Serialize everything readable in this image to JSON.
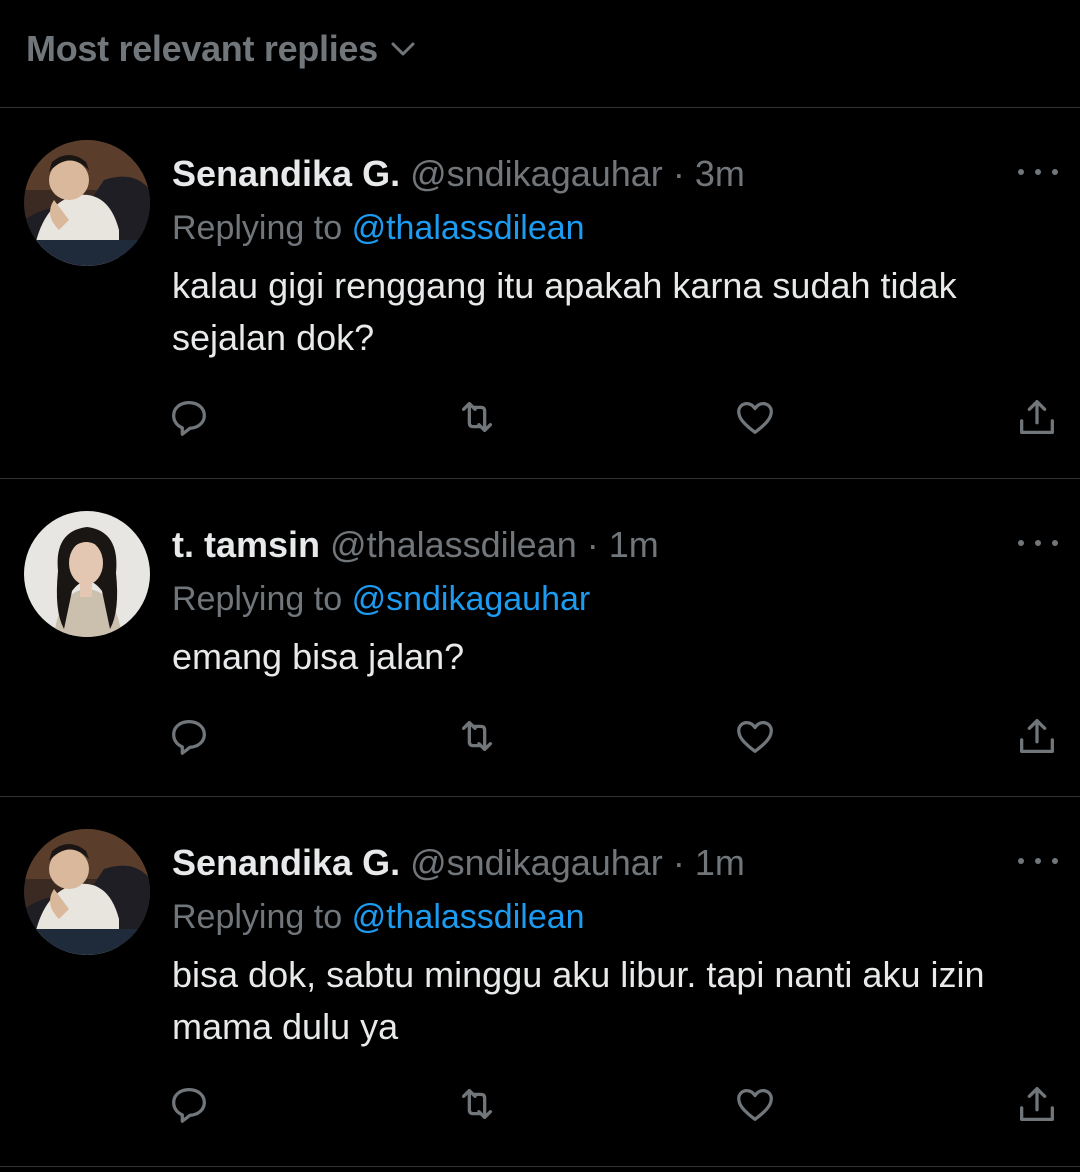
{
  "header": {
    "sort_label": "Most relevant replies",
    "chevron_icon": "chevron-down-icon"
  },
  "colors": {
    "background": "#000000",
    "primary_text": "#e7e9ea",
    "secondary_text": "#71767b",
    "link": "#1d9bf0",
    "divider": "#2f3336"
  },
  "tweets": [
    {
      "display_name": "Senandika G.",
      "handle": "@sndikagauhar",
      "separator": "·",
      "time": "3m",
      "replying_prefix": "Replying to",
      "replying_to": "@thalassdilean",
      "text": "kalau gigi renggang itu apakah karna sudah tidak sejalan dok?"
    },
    {
      "display_name": "t. tamsin",
      "handle": "@thalassdilean",
      "separator": "·",
      "time": "1m",
      "replying_prefix": "Replying to",
      "replying_to": "@sndikagauhar",
      "text": "emang bisa jalan?"
    },
    {
      "display_name": "Senandika G.",
      "handle": "@sndikagauhar",
      "separator": "·",
      "time": "1m",
      "replying_prefix": "Replying to",
      "replying_to": "@thalassdilean",
      "text": "bisa dok, sabtu minggu aku libur. tapi nanti aku izin mama dulu ya"
    }
  ],
  "action_icons": [
    "reply-icon",
    "retweet-icon",
    "like-icon",
    "share-icon"
  ]
}
